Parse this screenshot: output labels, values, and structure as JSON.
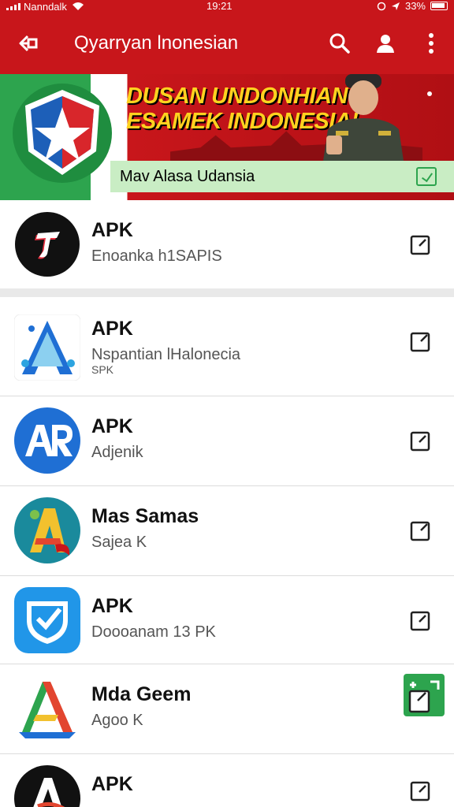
{
  "status_bar": {
    "carrier": "Nanndalk",
    "time": "19:21",
    "battery": "33%"
  },
  "app_bar": {
    "title": "Qyarryan lnonesian",
    "back_icon": "arrow-back-icon",
    "search_icon": "search-icon",
    "account_icon": "account-icon",
    "more_icon": "more-vert-icon"
  },
  "banner": {
    "headline_line1": "DUSAN UNDONHIAN",
    "headline_line2": "ESAMEK INDONESIA!",
    "subtitle": "Mav Alasa Udansia",
    "colors": {
      "red": "#c8161b",
      "green": "#2da44e",
      "yellow": "#ffd21f",
      "light_green": "#c9edc4"
    }
  },
  "apps": [
    {
      "name": "APK",
      "subtitle": "Enoanka h1SAPIS",
      "icon": "tiktok-style-icon"
    },
    {
      "name": "APK",
      "subtitle": "Nspantian lHalonecia",
      "subtitle2": "SPK",
      "icon": "arrow-a-icon"
    },
    {
      "name": "APK",
      "subtitle": "Adjenik",
      "icon": "ar-logo-icon"
    },
    {
      "name": "Mas Samas",
      "subtitle": "Sajea K",
      "icon": "colorful-a-icon"
    },
    {
      "name": "APK",
      "subtitle": "Doooanam 13 PK",
      "icon": "shield-check-icon"
    },
    {
      "name": "Mda Geem",
      "subtitle": "Agoo K",
      "icon": "tricolor-a-icon"
    },
    {
      "name": "APK",
      "subtitle": "",
      "icon": "black-a-icon"
    }
  ]
}
